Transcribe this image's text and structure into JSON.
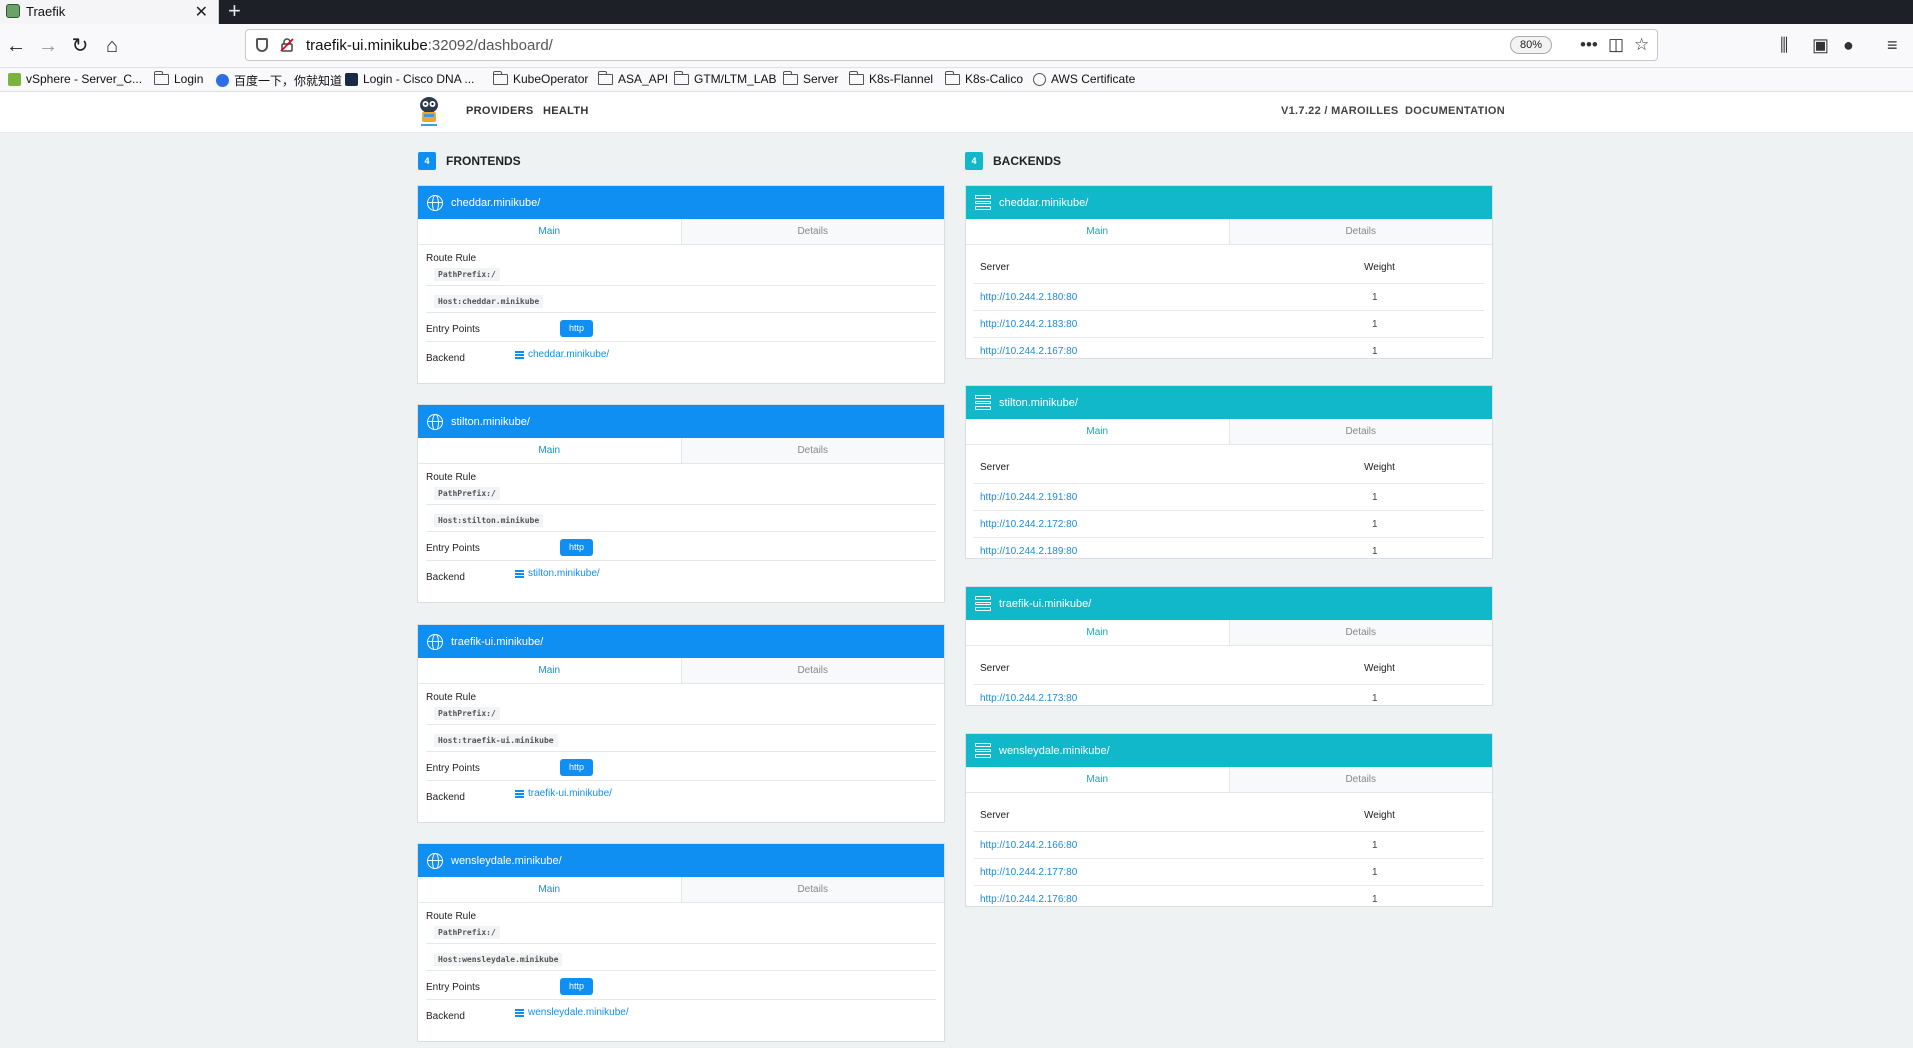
{
  "browser": {
    "tab_title": "Traefik",
    "url_host": "traefik-ui.minikube",
    "url_rest": ":32092/dashboard/",
    "zoom": "80%",
    "bookmarks": [
      {
        "label": "vSphere - Server_C...",
        "icon": "vsphere-icon"
      },
      {
        "label": "Login",
        "icon": "folder-icon"
      },
      {
        "label": "百度一下，你就知道",
        "icon": "baidu-icon"
      },
      {
        "label": "Login - Cisco DNA ...",
        "icon": "cisco-icon"
      },
      {
        "label": "KubeOperator",
        "icon": "folder-icon"
      },
      {
        "label": "ASA_API",
        "icon": "folder-icon"
      },
      {
        "label": "GTM/LTM_LAB",
        "icon": "folder-icon"
      },
      {
        "label": "Server",
        "icon": "folder-icon"
      },
      {
        "label": "K8s-Flannel",
        "icon": "folder-icon"
      },
      {
        "label": "K8s-Calico",
        "icon": "folder-icon"
      },
      {
        "label": "AWS Certificate",
        "icon": "aws-icon"
      }
    ]
  },
  "header": {
    "nav_providers": "PROVIDERS",
    "nav_health": "HEALTH",
    "version": "V1.7.22 / MAROILLES",
    "documentation": "DOCUMENTATION"
  },
  "frontends": {
    "count": "4",
    "title": "FRONTENDS",
    "tab_main": "Main",
    "tab_details": "Details",
    "route_rule_label": "Route Rule",
    "entry_points_label": "Entry Points",
    "backend_label": "Backend",
    "items": [
      {
        "name": "cheddar.minikube/",
        "rule_path": "PathPrefix:/",
        "rule_host": "Host:cheddar.minikube",
        "entry": "http",
        "backend": "cheddar.minikube/"
      },
      {
        "name": "stilton.minikube/",
        "rule_path": "PathPrefix:/",
        "rule_host": "Host:stilton.minikube",
        "entry": "http",
        "backend": "stilton.minikube/"
      },
      {
        "name": "traefik-ui.minikube/",
        "rule_path": "PathPrefix:/",
        "rule_host": "Host:traefik-ui.minikube",
        "entry": "http",
        "backend": "traefik-ui.minikube/"
      },
      {
        "name": "wensleydale.minikube/",
        "rule_path": "PathPrefix:/",
        "rule_host": "Host:wensleydale.minikube",
        "entry": "http",
        "backend": "wensleydale.minikube/"
      }
    ]
  },
  "backends": {
    "count": "4",
    "title": "BACKENDS",
    "tab_main": "Main",
    "tab_details": "Details",
    "server_header": "Server",
    "weight_header": "Weight",
    "items": [
      {
        "name": "cheddar.minikube/",
        "servers": [
          {
            "url": "http://10.244.2.180:80",
            "weight": "1"
          },
          {
            "url": "http://10.244.2.183:80",
            "weight": "1"
          },
          {
            "url": "http://10.244.2.167:80",
            "weight": "1"
          }
        ]
      },
      {
        "name": "stilton.minikube/",
        "servers": [
          {
            "url": "http://10.244.2.191:80",
            "weight": "1"
          },
          {
            "url": "http://10.244.2.172:80",
            "weight": "1"
          },
          {
            "url": "http://10.244.2.189:80",
            "weight": "1"
          }
        ]
      },
      {
        "name": "traefik-ui.minikube/",
        "servers": [
          {
            "url": "http://10.244.2.173:80",
            "weight": "1"
          }
        ]
      },
      {
        "name": "wensleydale.minikube/",
        "servers": [
          {
            "url": "http://10.244.2.166:80",
            "weight": "1"
          },
          {
            "url": "http://10.244.2.177:80",
            "weight": "1"
          },
          {
            "url": "http://10.244.2.176:80",
            "weight": "1"
          }
        ]
      }
    ]
  },
  "colors": {
    "frontend_accent": "#0f8ff2",
    "backend_accent": "#11b8c9"
  }
}
